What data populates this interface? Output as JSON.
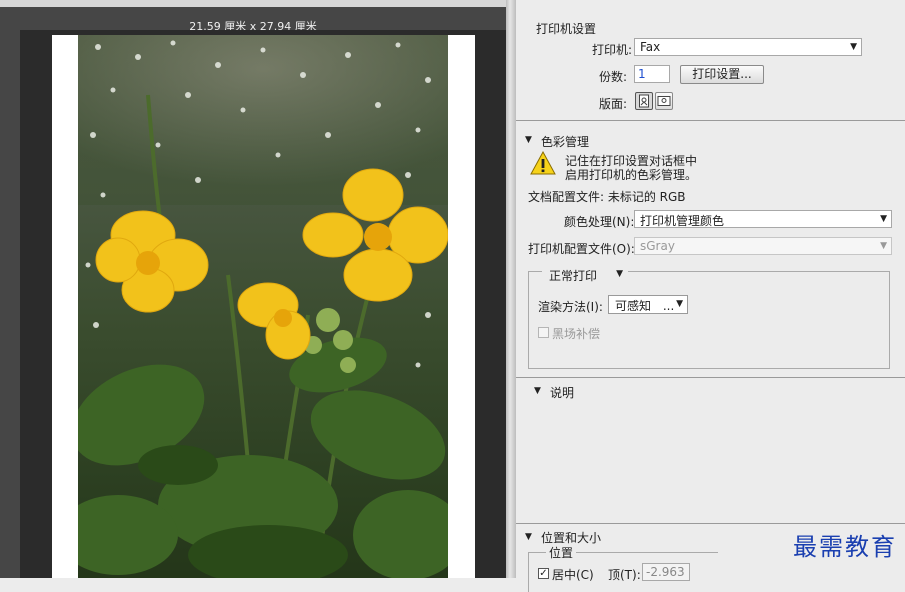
{
  "preview": {
    "dimensions": "21.59 厘米 x 27.94 厘米"
  },
  "printer_setup": {
    "title": "打印机设置",
    "printer_label": "打印机:",
    "printer_value": "Fax",
    "copies_label": "份数:",
    "copies_value": "1",
    "print_settings_button": "打印设置...",
    "layout_label": "版面:"
  },
  "color_management": {
    "title": "色彩管理",
    "warning_line1": "记住在打印设置对话框中",
    "warning_line2": "启用打印机的色彩管理。",
    "doc_profile": "文档配置文件: 未标记的 RGB",
    "color_handling_label": "颜色处理(N):",
    "color_handling_value": "打印机管理颜色",
    "printer_profile_label": "打印机配置文件(O):",
    "printer_profile_value": "sGray",
    "print_mode": "正常打印",
    "rendering_label": "渲染方法(I):",
    "rendering_value": "可感知",
    "rendering_ellipsis": "...",
    "black_point_label": "黑场补偿"
  },
  "description": {
    "title": "说明"
  },
  "position_size": {
    "title": "位置和大小",
    "position_group": "位置",
    "center_label": "居中(C)",
    "top_label": "顶(T):",
    "top_value": "-2.963"
  },
  "watermark": "最需教育"
}
